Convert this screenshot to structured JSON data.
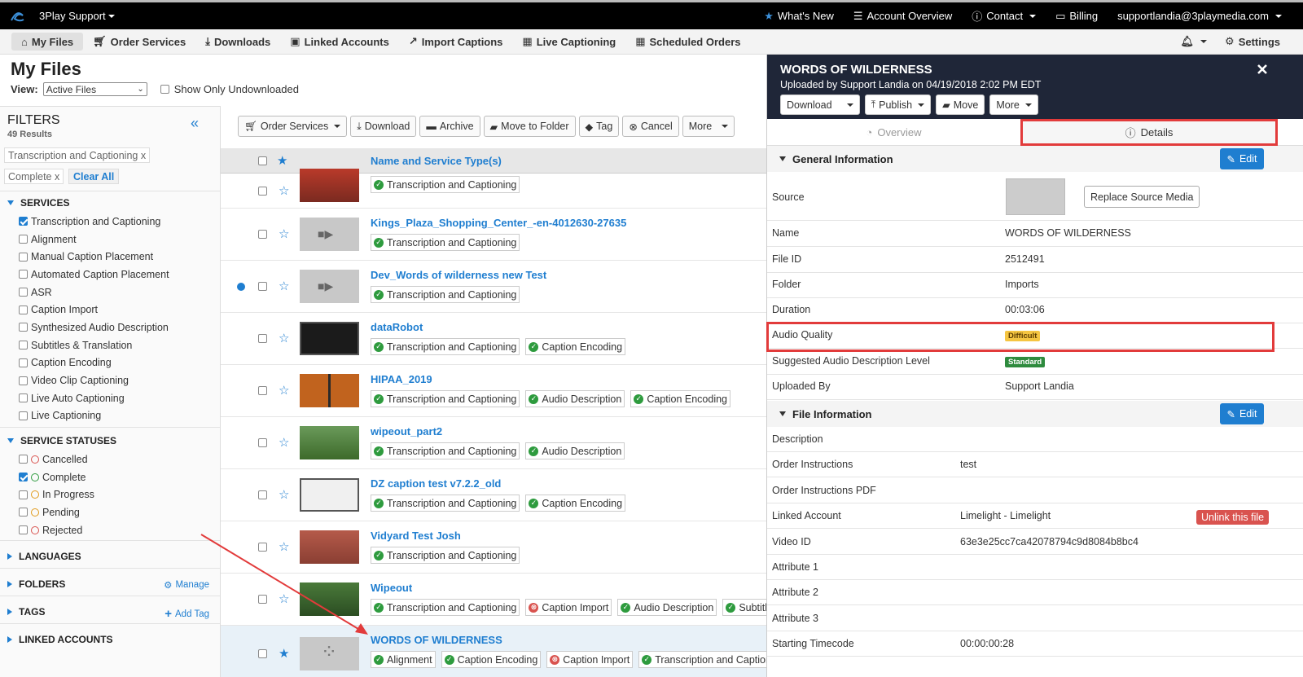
{
  "topbar": {
    "brand": "3Play Support",
    "whats_new": "What's New",
    "account_overview": "Account Overview",
    "contact": "Contact",
    "billing": "Billing",
    "user": "supportlandia@3playmedia.com"
  },
  "nav": {
    "my_files": "My Files",
    "order_services": "Order Services",
    "downloads": "Downloads",
    "linked_accounts": "Linked Accounts",
    "import_captions": "Import Captions",
    "live_captioning": "Live Captioning",
    "scheduled_orders": "Scheduled Orders",
    "settings": "Settings"
  },
  "page": {
    "title": "My Files",
    "view_label": "View:",
    "view_value": "Active Files",
    "show_undownloaded": "Show Only Undownloaded"
  },
  "filters": {
    "title": "FILTERS",
    "results": "49 Results",
    "chips": [
      "Transcription and Captioning x",
      "Complete x"
    ],
    "clear_all": "Clear All",
    "services_title": "SERVICES",
    "services": [
      {
        "label": "Transcription and Captioning",
        "checked": true
      },
      {
        "label": "Alignment",
        "checked": false
      },
      {
        "label": "Manual Caption Placement",
        "checked": false
      },
      {
        "label": "Automated Caption Placement",
        "checked": false
      },
      {
        "label": "ASR",
        "checked": false
      },
      {
        "label": "Caption Import",
        "checked": false
      },
      {
        "label": "Synthesized Audio Description",
        "checked": false
      },
      {
        "label": "Subtitles & Translation",
        "checked": false
      },
      {
        "label": "Caption Encoding",
        "checked": false
      },
      {
        "label": "Video Clip Captioning",
        "checked": false
      },
      {
        "label": "Live Auto Captioning",
        "checked": false
      },
      {
        "label": "Live Captioning",
        "checked": false
      }
    ],
    "statuses_title": "SERVICE STATUSES",
    "statuses": [
      {
        "label": "Cancelled",
        "checked": false,
        "color": "#d9534f"
      },
      {
        "label": "Complete",
        "checked": true,
        "color": "#2e9b3e"
      },
      {
        "label": "In Progress",
        "checked": false,
        "color": "#e09a1a"
      },
      {
        "label": "Pending",
        "checked": false,
        "color": "#e09a1a"
      },
      {
        "label": "Rejected",
        "checked": false,
        "color": "#d9534f"
      }
    ],
    "languages": "LANGUAGES",
    "folders": "FOLDERS",
    "manage": "Manage",
    "tags": "TAGS",
    "add_tag": "Add Tag",
    "linked_accounts": "LINKED ACCOUNTS"
  },
  "toolbar": {
    "order_services": "Order Services",
    "download": "Download",
    "archive": "Archive",
    "move_to_folder": "Move to Folder",
    "tag": "Tag",
    "cancel": "Cancel",
    "more": "More"
  },
  "list": {
    "header": "Name and Service Type(s)",
    "rows": [
      {
        "name": "",
        "tags": [
          {
            "label": "Transcription and Captioning",
            "status": "complete"
          }
        ]
      },
      {
        "name": "Kings_Plaza_Shopping_Center_-en-4012630-27635",
        "tags": [
          {
            "label": "Transcription and Captioning",
            "status": "complete"
          }
        ]
      },
      {
        "name": "Dev_Words of wilderness new Test",
        "tags": [
          {
            "label": "Transcription and Captioning",
            "status": "complete"
          }
        ]
      },
      {
        "name": "dataRobot",
        "tags": [
          {
            "label": "Transcription and Captioning",
            "status": "complete"
          },
          {
            "label": "Caption Encoding",
            "status": "complete"
          }
        ]
      },
      {
        "name": "HIPAA_2019",
        "tags": [
          {
            "label": "Transcription and Captioning",
            "status": "complete"
          },
          {
            "label": "Audio Description",
            "status": "complete"
          },
          {
            "label": "Caption Encoding",
            "status": "complete"
          }
        ]
      },
      {
        "name": "wipeout_part2",
        "tags": [
          {
            "label": "Transcription and Captioning",
            "status": "complete"
          },
          {
            "label": "Audio Description",
            "status": "complete"
          }
        ]
      },
      {
        "name": "DZ caption test v7.2.2_old",
        "tags": [
          {
            "label": "Transcription and Captioning",
            "status": "complete"
          },
          {
            "label": "Caption Encoding",
            "status": "complete"
          }
        ]
      },
      {
        "name": "Vidyard Test Josh",
        "tags": [
          {
            "label": "Transcription and Captioning",
            "status": "complete"
          }
        ]
      },
      {
        "name": "Wipeout",
        "tags": [
          {
            "label": "Transcription and Captioning",
            "status": "complete"
          },
          {
            "label": "Caption Import",
            "status": "error"
          },
          {
            "label": "Audio Description",
            "status": "complete"
          },
          {
            "label": "Subtitl",
            "status": "complete"
          }
        ]
      },
      {
        "name": "WORDS OF WILDERNESS",
        "tags": [
          {
            "label": "Alignment",
            "status": "complete"
          },
          {
            "label": "Caption Encoding",
            "status": "complete"
          },
          {
            "label": "Caption Import",
            "status": "error"
          },
          {
            "label": "Transcription and Caption",
            "status": "complete"
          }
        ]
      }
    ]
  },
  "panel": {
    "title": "WORDS OF WILDERNESS",
    "subtitle": "Uploaded by Support Landia on 04/19/2018 2:02 PM EDT",
    "download": "Download",
    "publish": "Publish",
    "move": "Move",
    "more": "More",
    "tab_overview": "Overview",
    "tab_details": "Details",
    "general_title": "General Information",
    "edit": "Edit",
    "source_label": "Source",
    "replace": "Replace Source Media",
    "general_rows": [
      {
        "label": "Name",
        "value": "WORDS OF WILDERNESS"
      },
      {
        "label": "File ID",
        "value": "2512491"
      },
      {
        "label": "Folder",
        "value": "Imports"
      },
      {
        "label": "Duration",
        "value": "00:03:06"
      },
      {
        "label": "Audio Quality",
        "value": "Difficult"
      },
      {
        "label": "Suggested Audio Description Level",
        "value": "Standard"
      },
      {
        "label": "Uploaded By",
        "value": "Support Landia"
      }
    ],
    "file_title": "File Information",
    "file_rows": [
      {
        "label": "Description",
        "value": ""
      },
      {
        "label": "Order Instructions",
        "value": "test"
      },
      {
        "label": "Order Instructions PDF",
        "value": ""
      },
      {
        "label": "Linked Account",
        "value": "Limelight - Limelight"
      },
      {
        "label": "Video ID",
        "value": "63e3e25cc7ca42078794c9d8084b8bc4"
      },
      {
        "label": "Attribute 1",
        "value": ""
      },
      {
        "label": "Attribute 2",
        "value": ""
      },
      {
        "label": "Attribute 3",
        "value": ""
      },
      {
        "label": "Starting Timecode",
        "value": "00:00:00:28"
      }
    ],
    "unlink": "Unlink this file"
  },
  "colors": {
    "accent": "#1f7ed0",
    "highlight": "#e23b3b",
    "difficult_badge": "#f5c542",
    "standard_badge": "#2e8b3e",
    "panel_header": "#1f2638"
  }
}
